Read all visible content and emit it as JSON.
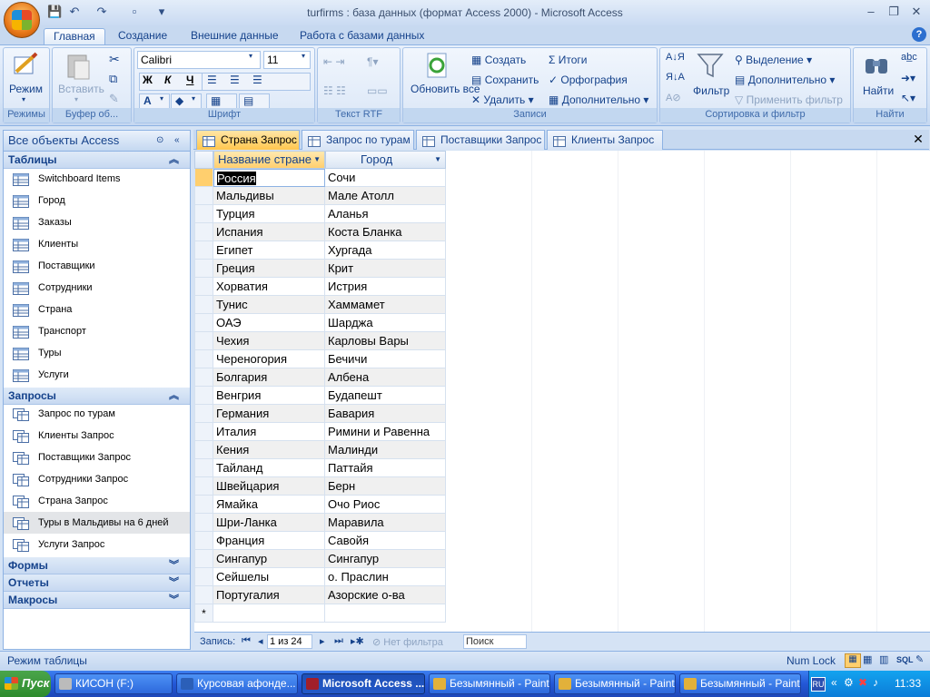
{
  "window": {
    "title": "turfirms : база данных (формат Access 2000) - Microsoft Access"
  },
  "ribbon": {
    "tabs": [
      "Главная",
      "Создание",
      "Внешние данные",
      "Работа с базами данных"
    ],
    "active_tab": "Главная",
    "groups": {
      "modes": {
        "label": "Режимы",
        "view_button": "Режим"
      },
      "clipboard": {
        "label": "Буфер об...",
        "paste_button": "Вставить"
      },
      "font": {
        "label": "Шрифт",
        "font_name": "Calibri",
        "font_size": "11",
        "bold": "Ж",
        "italic": "К",
        "underline": "Ч",
        "font_color_letter": "A"
      },
      "rtf": {
        "label": "Текст RTF"
      },
      "records": {
        "label": "Записи",
        "refresh_button": "Обновить все",
        "create": "Создать",
        "save": "Сохранить",
        "delete": "Удалить",
        "totals": "Итоги",
        "spelling": "Орфография",
        "more": "Дополнительно"
      },
      "sort_filter": {
        "label": "Сортировка и фильтр",
        "filter_button": "Фильтр",
        "selection": "Выделение",
        "advanced": "Дополнительно",
        "toggle_filter": "Применить фильтр"
      },
      "find": {
        "label": "Найти",
        "find_button": "Найти"
      }
    }
  },
  "nav": {
    "header": "Все объекты Access",
    "sections": {
      "tables": {
        "title": "Таблицы",
        "items": [
          "Switchboard Items",
          "Город",
          "Заказы",
          "Клиенты",
          "Поставщики",
          "Сотрудники",
          "Страна",
          "Транспорт",
          "Туры",
          "Услуги"
        ]
      },
      "queries": {
        "title": "Запросы",
        "items": [
          "Запрос по турам",
          "Клиенты Запрос",
          "Поставщики Запрос",
          "Сотрудники Запрос",
          "Страна Запрос",
          "Туры в Мальдивы на 6 дней",
          "Услуги Запрос"
        ],
        "selected_index": 5
      },
      "forms": {
        "title": "Формы"
      },
      "reports": {
        "title": "Отчеты"
      },
      "macros": {
        "title": "Макросы"
      }
    }
  },
  "document_tabs": [
    "Страна Запрос",
    "Запрос по турам",
    "Поставщики Запрос",
    "Клиенты Запрос"
  ],
  "active_document_tab": "Страна Запрос",
  "datasheet": {
    "columns": [
      "Название стране",
      "Город"
    ],
    "rows": [
      [
        "Россия",
        "Сочи"
      ],
      [
        "Мальдивы",
        "Мале Атолл"
      ],
      [
        "Турция",
        "Аланья"
      ],
      [
        "Испания",
        "Коста Бланка"
      ],
      [
        "Египет",
        "Хургада"
      ],
      [
        "Греция",
        "Крит"
      ],
      [
        "Хорватия",
        "Истрия"
      ],
      [
        "Тунис",
        "Хаммамет"
      ],
      [
        "ОАЭ",
        "Шарджа"
      ],
      [
        "Чехия",
        "Карловы Вары"
      ],
      [
        "Череногория",
        "Бечичи"
      ],
      [
        "Болгария",
        "Албена"
      ],
      [
        "Венгрия",
        "Будапешт"
      ],
      [
        "Германия",
        "Бавария"
      ],
      [
        "Италия",
        "Римини и Равенна"
      ],
      [
        "Кения",
        "Малинди"
      ],
      [
        "Тайланд",
        "Паттайя"
      ],
      [
        "Швейцария",
        "Берн"
      ],
      [
        "Ямайка",
        "Очо Риос"
      ],
      [
        "Шри-Ланка",
        "Маравила"
      ],
      [
        "Франция",
        "Савойя"
      ],
      [
        "Сингапур",
        "Сингапур"
      ],
      [
        "Сейшелы",
        "о. Праслин"
      ],
      [
        "Португалия",
        "Азорские о-ва"
      ]
    ],
    "new_row_marker": "*"
  },
  "record_nav": {
    "label": "Запись:",
    "position": "1 из 24",
    "filter_status": "Нет фильтра",
    "search_placeholder": "Поиск"
  },
  "status": {
    "left": "Режим таблицы",
    "num_lock": "Num Lock",
    "sql": "SQL"
  },
  "taskbar": {
    "start": "Пуск",
    "tasks": [
      "КИСОН (F:)",
      "Курсовая афонде...",
      "Microsoft Access ...",
      "Безымянный - Paint",
      "Безымянный - Paint",
      "Безымянный - Paint"
    ],
    "active_task_index": 2,
    "lang": "RU",
    "clock": "11:33"
  }
}
